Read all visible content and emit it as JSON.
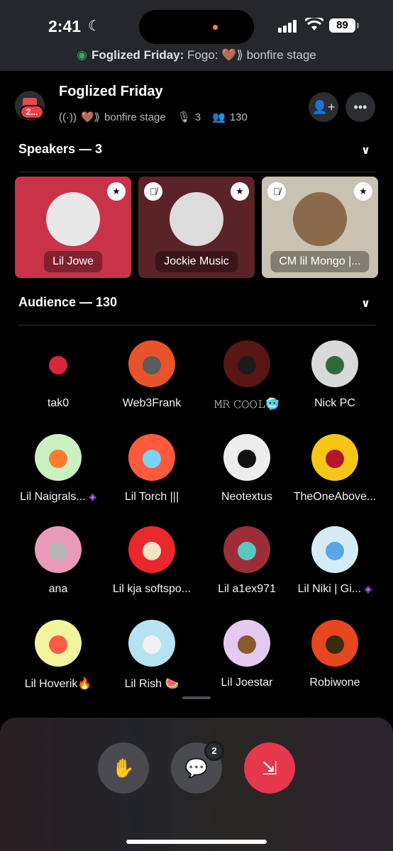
{
  "status_bar": {
    "time": "2:41",
    "battery": "89"
  },
  "stage_banner": {
    "server": "Foglized Friday:",
    "stage": "Fogo: 🤎⟫ bonfire stage"
  },
  "header": {
    "server_badge": "2...",
    "title": "Foglized Friday",
    "stage_name": "bonfire stage",
    "speaker_count": "3",
    "listener_count": "130"
  },
  "speakers_section": {
    "label": "Speakers — 3"
  },
  "speakers": [
    {
      "name": "Lil Jowe",
      "bg": "#c8334a",
      "art": "#e8e8e8",
      "muted": false
    },
    {
      "name": "Jockie Music",
      "bg": "#5a2328",
      "art": "#dcdcdc",
      "muted": true
    },
    {
      "name": "CM lil Mongo |...",
      "bg": "#c9c2b3",
      "art": "#8a6a4a",
      "muted": true
    }
  ],
  "audience_section": {
    "label": "Audience — 130"
  },
  "audience": [
    {
      "name": "tak0",
      "color": "#000000",
      "face": "#d7263d"
    },
    {
      "name": "Web3Frank",
      "color": "#e8532b",
      "face": "#5c5c5c"
    },
    {
      "name": "𝙼𝚁 𝙲𝙾𝙾𝙻🥶",
      "color": "#5a1515",
      "face": "#1c1c1c"
    },
    {
      "name": "Nick PC",
      "color": "#d9d9d9",
      "face": "#2f6b3a"
    },
    {
      "name": "Lil Naigrals...",
      "color": "#c9f2c0",
      "face": "#ff7a2f",
      "gem": true
    },
    {
      "name": "Lil Torch |||",
      "color": "#ff5a3d",
      "face": "#7ad3f5"
    },
    {
      "name": "Neotextus",
      "color": "#ededed",
      "face": "#111111"
    },
    {
      "name": "TheOneAbove...",
      "color": "#f5c518",
      "face": "#b3152a"
    },
    {
      "name": "ana",
      "color": "#e89ab8",
      "face": "#b5b5b5"
    },
    {
      "name": "Lil kja softspo...",
      "color": "#e8282b",
      "face": "#f5e3c8"
    },
    {
      "name": "Lil a1ex971",
      "color": "#9e2d3a",
      "face": "#57c7c4"
    },
    {
      "name": "Lil Niki | Gi...",
      "color": "#d5ecf7",
      "face": "#58a8e8",
      "gem": true
    },
    {
      "name": "Lil Hoverik🔥",
      "color": "#f1f59b",
      "face": "#ff5b4a"
    },
    {
      "name": "Lil Rish 🍉",
      "color": "#b7e2f2",
      "face": "#f0f0f0"
    },
    {
      "name": "Lil Joestar",
      "color": "#e6c9f2",
      "face": "#8b5a2b"
    },
    {
      "name": "Robiwone",
      "color": "#e8461e",
      "face": "#3b2a12"
    }
  ],
  "controls": {
    "message_count": "2"
  }
}
